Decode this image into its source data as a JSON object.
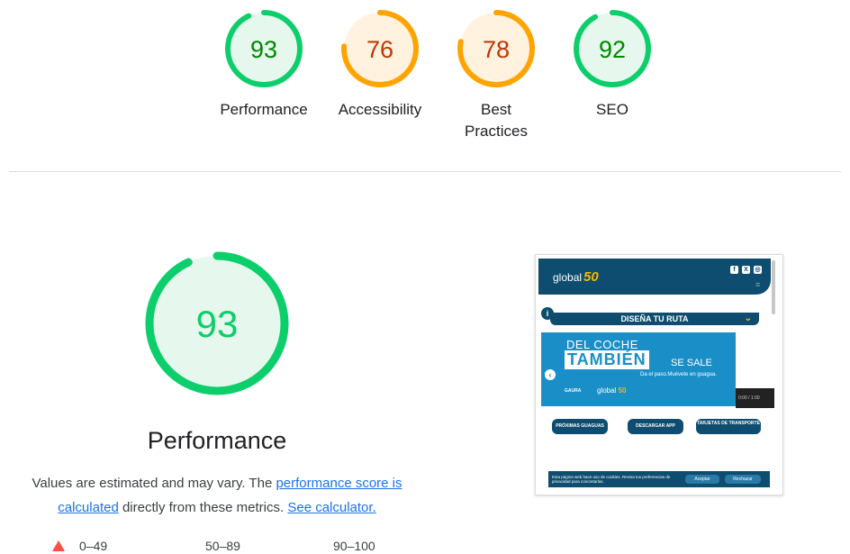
{
  "gauges": [
    {
      "label": "Performance",
      "score": 93,
      "color": "#0cce6b",
      "text_color": "#008800",
      "fill": "#e6f8ee"
    },
    {
      "label": "Accessibility",
      "score": 76,
      "color": "#ffa400",
      "text_color": "#c33300",
      "fill": "#fff3e0"
    },
    {
      "label": "Best Practices",
      "score": 78,
      "color": "#ffa400",
      "text_color": "#c33300",
      "fill": "#fff3e0"
    },
    {
      "label": "SEO",
      "score": 92,
      "color": "#0cce6b",
      "text_color": "#008800",
      "fill": "#e6f8ee"
    }
  ],
  "performance": {
    "score": 93,
    "title": "Performance",
    "color": "#0cce6b",
    "desc_prefix": "Values are estimated and may vary. The ",
    "link1": "performance score is calculated",
    "desc_middle": " directly from these metrics. ",
    "link2": "See calculator."
  },
  "legend": {
    "fail": "0–49",
    "average": "50–89",
    "pass": "90–100",
    "fail_color": "#ff4e42"
  },
  "screenshot": {
    "logo_text": "global",
    "logo_mark": "50",
    "route_label": "DISEÑA TU RUTA",
    "banner_line1": "DEL COCHE",
    "banner_word": "TAMBIÉN",
    "banner_end": "SE SALE",
    "banner_sub": "Da el paso.Muévete en guagua.",
    "banner_logo": "global",
    "banner_logo_mark": "50",
    "banner_small": "GAURA",
    "video_time": "0:00 / 1:00",
    "buttons": [
      "PRÓXIMAS GUAGUAS",
      "DESCARGAR APP",
      "TARJETAS DE TRANSPORTE"
    ],
    "cookie_text": "Esta página web hace uso de cookies. Revisa tus preferencias de privacidad para concretarlas.",
    "cookie_accept": "Aceptar",
    "cookie_reject": "Rechazar"
  }
}
